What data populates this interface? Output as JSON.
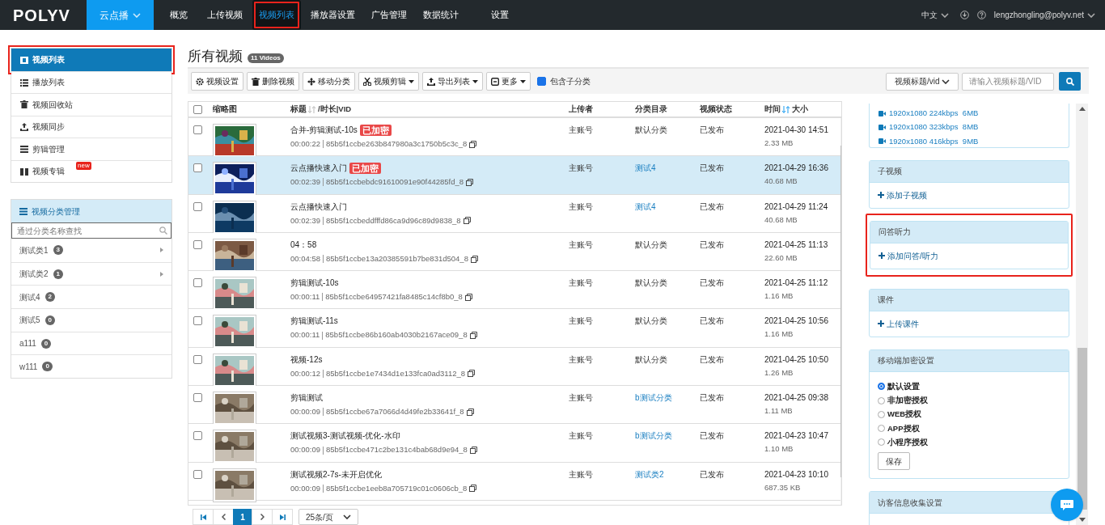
{
  "top_nav": {
    "brand": "POLYV",
    "product": "云点播",
    "items": [
      {
        "label": "概览",
        "selected": false,
        "annotated": false
      },
      {
        "label": "上传视频",
        "selected": false,
        "annotated": false
      },
      {
        "label": "视频列表",
        "selected": true,
        "annotated": true
      },
      {
        "label": "播放器设置",
        "selected": false,
        "annotated": false
      },
      {
        "label": "广告管理",
        "selected": false,
        "annotated": false
      },
      {
        "label": "数据统计",
        "selected": false,
        "annotated": false
      },
      {
        "label": "设置",
        "selected": false,
        "annotated": false
      }
    ],
    "language": "中文",
    "account": "lengzhongling@polyv.net"
  },
  "sidebar": {
    "items": [
      {
        "kind": "film",
        "label": "视频列表",
        "selected": true,
        "annotated": true
      },
      {
        "kind": "list",
        "label": "播放列表",
        "selected": false,
        "annotated": false
      },
      {
        "kind": "trash",
        "label": "视频回收站",
        "selected": false,
        "annotated": false
      },
      {
        "kind": "sync",
        "label": "视频同步",
        "selected": false,
        "annotated": false
      },
      {
        "kind": "edit",
        "label": "剪辑管理",
        "selected": false,
        "annotated": false
      },
      {
        "kind": "album",
        "label": "视频专辑",
        "selected": false,
        "annotated": false,
        "badge": "new"
      }
    ],
    "categories": {
      "title": "视频分类管理",
      "search_placeholder": "通过分类名称查找",
      "items": [
        {
          "name": "测试类1",
          "count": "3",
          "expandable": true
        },
        {
          "name": "测试类2",
          "count": "1",
          "expandable": true
        },
        {
          "name": "测试4",
          "count": "2",
          "expandable": false
        },
        {
          "name": "测试5",
          "count": "0",
          "expandable": false
        },
        {
          "name": "a111",
          "count": "0",
          "expandable": false
        },
        {
          "name": "w111",
          "count": "0",
          "expandable": false
        }
      ]
    }
  },
  "main": {
    "title": "所有视频",
    "count_badge": "11 Videos",
    "toolbar": [
      {
        "kind": "gear",
        "label": "视频设置",
        "dropdown": false
      },
      {
        "kind": "trash",
        "label": "删除视频",
        "dropdown": false
      },
      {
        "kind": "move",
        "label": "移动分类",
        "dropdown": false
      },
      {
        "kind": "scissors",
        "label": "视频剪辑",
        "dropdown": true
      },
      {
        "kind": "export",
        "label": "导出列表",
        "dropdown": true
      },
      {
        "kind": "more",
        "label": "更多",
        "dropdown": true
      }
    ],
    "include_subcategories": {
      "label": "包含子分类",
      "checked": true
    },
    "search": {
      "field": "视频标题/vid",
      "placeholder": "请输入视频标题/VID"
    },
    "table": {
      "select_all_checked": false,
      "columns": [
        "缩略图",
        "标题",
        "/时长|VID",
        "上传者",
        "分类目录",
        "视频状态",
        "时间",
        "大小"
      ],
      "rows": [
        {
          "title": "合并-剪辑测试-10s",
          "badge": "已加密",
          "duration": "00:00:22",
          "vid": "85b5f1ccbe263b847980a3c1750b5c3c_8",
          "uploader": "主账号",
          "category": "默认分类",
          "category_link": false,
          "status": "已发布",
          "time": "2021-04-30 14:51",
          "size": "2.33 MB",
          "selected": false,
          "checked": false
        },
        {
          "title": "云点播快速入门",
          "badge": "已加密",
          "duration": "00:02:39",
          "vid": "85b5f1ccbebdc91610091e90f44285fd_8",
          "uploader": "主账号",
          "category": "测试4",
          "category_link": true,
          "status": "已发布",
          "time": "2021-04-29 16:36",
          "size": "40.68 MB",
          "selected": true,
          "checked": false
        },
        {
          "title": "云点播快速入门",
          "duration": "00:02:39",
          "vid": "85b5f1ccbeddfffd86ca9d96c89d9838_8",
          "uploader": "主账号",
          "category": "测试4",
          "category_link": true,
          "status": "已发布",
          "time": "2021-04-29 11:24",
          "size": "40.68 MB",
          "selected": false,
          "checked": false
        },
        {
          "title": "04：58",
          "duration": "00:04:58",
          "vid": "85b5f1ccbe13a20385591b7be831d504_8",
          "uploader": "主账号",
          "category": "默认分类",
          "category_link": false,
          "status": "已发布",
          "time": "2021-04-25 11:13",
          "size": "22.60 MB",
          "selected": false,
          "checked": false
        },
        {
          "title": "剪辑测试-10s",
          "duration": "00:00:11",
          "vid": "85b5f1ccbe64957421fa8485c14cf8b0_8",
          "uploader": "主账号",
          "category": "默认分类",
          "category_link": false,
          "status": "已发布",
          "time": "2021-04-25 11:12",
          "size": "1.16 MB",
          "selected": false,
          "checked": false
        },
        {
          "title": "剪辑测试-11s",
          "duration": "00:00:11",
          "vid": "85b5f1ccbe86b160ab4030b2167ace09_8",
          "uploader": "主账号",
          "category": "默认分类",
          "category_link": false,
          "status": "已发布",
          "time": "2021-04-25 10:56",
          "size": "1.16 MB",
          "selected": false,
          "checked": false
        },
        {
          "title": "视频-12s",
          "duration": "00:00:12",
          "vid": "85b5f1ccbe1e7434d1e133fca0ad3112_8",
          "uploader": "主账号",
          "category": "默认分类",
          "category_link": false,
          "status": "已发布",
          "time": "2021-04-25 10:50",
          "size": "1.26 MB",
          "selected": false,
          "checked": false
        },
        {
          "title": "剪辑测试",
          "duration": "00:00:09",
          "vid": "85b5f1ccbe67a7066d4d49fe2b33641f_8",
          "uploader": "主账号",
          "category": "b测试分类",
          "category_link": true,
          "status": "已发布",
          "time": "2021-04-25 09:38",
          "size": "1.11 MB",
          "selected": false,
          "checked": false
        },
        {
          "title": "测试视频3-测试视频-优化-水印",
          "duration": "00:00:09",
          "vid": "85b5f1ccbe471c2be131c4bab68d9e94_8",
          "uploader": "主账号",
          "category": "b测试分类",
          "category_link": true,
          "status": "已发布",
          "time": "2021-04-23 10:47",
          "size": "1.10 MB",
          "selected": false,
          "checked": false
        },
        {
          "title": "测试视频2-7s-未开启优化",
          "duration": "00:00:09",
          "vid": "85b5f1ccbe1eeb8a705719c01c0606cb_8",
          "uploader": "主账号",
          "category": "测试类2",
          "category_link": true,
          "status": "已发布",
          "time": "2021-04-23 10:10",
          "size": "687.35 KB",
          "selected": false,
          "checked": false
        }
      ]
    },
    "pagination": {
      "pages": [
        {
          "label": "1",
          "selected": true
        }
      ],
      "page_size": "25条/页"
    }
  },
  "detail_panel": {
    "renditions": [
      "1920x1080 224kbps  6MB",
      "1920x1080 323kbps  8MB",
      "1920x1080 416kbps  9MB"
    ],
    "sections": [
      {
        "kind": "action",
        "title": "子视频",
        "action": "添加子视频",
        "annotated": false
      },
      {
        "kind": "action",
        "title": "问答听力",
        "action": "添加问答/听力",
        "annotated": true
      },
      {
        "kind": "action",
        "title": "课件",
        "action": "上传课件",
        "annotated": false
      },
      {
        "kind": "radios",
        "title": "移动端加密设置",
        "annotated": false,
        "options": [
          {
            "label": "默认设置",
            "selected": true
          },
          {
            "label": "非加密授权",
            "selected": false
          },
          {
            "label": "WEB授权",
            "selected": false
          },
          {
            "label": "APP授权",
            "selected": false
          },
          {
            "label": "小程序授权",
            "selected": false
          }
        ],
        "button": "保存"
      },
      {
        "kind": "header",
        "title": "访客信息收集设置",
        "annotated": false
      }
    ]
  }
}
